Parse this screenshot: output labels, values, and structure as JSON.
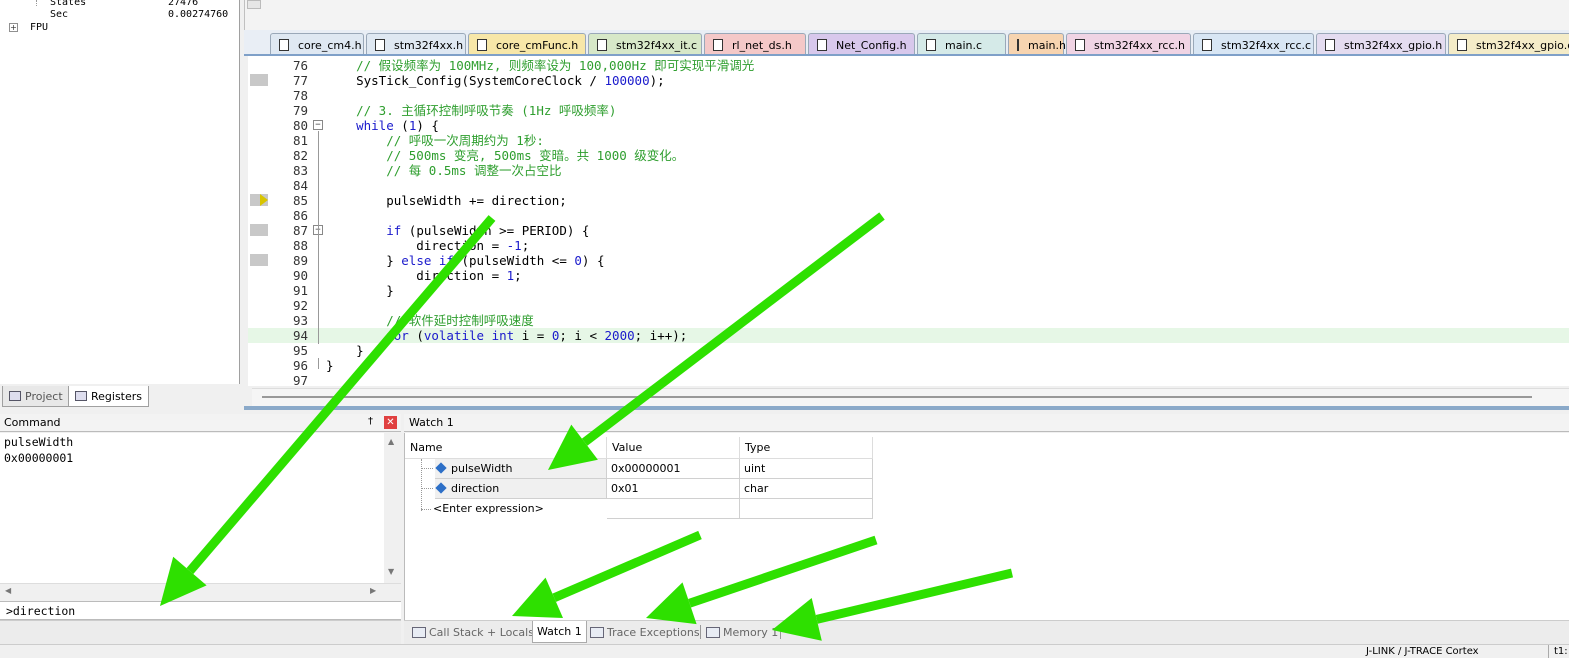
{
  "registers": {
    "rows": [
      {
        "name": "States",
        "value": "27476"
      },
      {
        "name": "Sec",
        "value": "0.00274760"
      }
    ],
    "tree_item": "FPU"
  },
  "left_tabs": [
    {
      "label": "Project",
      "icon": "project-icon"
    },
    {
      "label": "Registers",
      "icon": "registers-icon"
    }
  ],
  "file_tabs": [
    {
      "label": "core_cm4.h",
      "color": "#dfe8f2"
    },
    {
      "label": "stm32f4xx.h",
      "color": "#dfe8f2"
    },
    {
      "label": "core_cmFunc.h",
      "color": "#f7e7a8"
    },
    {
      "label": "stm32f4xx_it.c",
      "color": "#d7e8c8"
    },
    {
      "label": "rl_net_ds.h",
      "color": "#f4c8c8"
    },
    {
      "label": "Net_Config.h",
      "color": "#d8c8ec"
    },
    {
      "label": "main.c",
      "color": "#d5eae8"
    },
    {
      "label": "main.h",
      "color": "#f7d4b0"
    },
    {
      "label": "stm32f4xx_rcc.h",
      "color": "#f0d4e4"
    },
    {
      "label": "stm32f4xx_rcc.c",
      "color": "#d8e6f4"
    },
    {
      "label": "stm32f4xx_gpio.h",
      "color": "#e4dcf0"
    },
    {
      "label": "stm32f4xx_gpio.c",
      "color": "#f4ecc8"
    }
  ],
  "code_lines": [
    {
      "n": "76",
      "text": "    // 假设频率为 100MHz, 则频率设为 100,000Hz 即可实现平滑调光",
      "kind": "comment"
    },
    {
      "n": "77",
      "text": "    SysTick_Config(SystemCoreClock / 100000);",
      "kind": "code"
    },
    {
      "n": "78",
      "text": "",
      "kind": "code"
    },
    {
      "n": "79",
      "text": "    // 3. 主循环控制呼吸节奏 (1Hz 呼吸频率)",
      "kind": "comment"
    },
    {
      "n": "80",
      "text": "    while (1) {",
      "kind": "code"
    },
    {
      "n": "81",
      "text": "        // 呼吸一次周期约为 1秒:",
      "kind": "comment"
    },
    {
      "n": "82",
      "text": "        // 500ms 变亮, 500ms 变暗。共 1000 级变化。",
      "kind": "comment"
    },
    {
      "n": "83",
      "text": "        // 每 0.5ms 调整一次占空比",
      "kind": "comment"
    },
    {
      "n": "84",
      "text": "",
      "kind": "code"
    },
    {
      "n": "85",
      "text": "        pulseWidth += direction;",
      "kind": "code"
    },
    {
      "n": "86",
      "text": "",
      "kind": "code"
    },
    {
      "n": "87",
      "text": "        if (pulseWidth >= PERIOD) {",
      "kind": "code"
    },
    {
      "n": "88",
      "text": "            direction = -1;",
      "kind": "code"
    },
    {
      "n": "89",
      "text": "        } else if (pulseWidth <= 0) {",
      "kind": "code"
    },
    {
      "n": "90",
      "text": "            direction = 1;",
      "kind": "code"
    },
    {
      "n": "91",
      "text": "        }",
      "kind": "code"
    },
    {
      "n": "92",
      "text": "",
      "kind": "code"
    },
    {
      "n": "93",
      "text": "        // 软件延时控制呼吸速度",
      "kind": "comment"
    },
    {
      "n": "94",
      "text": "        for (volatile int i = 0; i < 2000; i++);",
      "kind": "code"
    },
    {
      "n": "95",
      "text": "    }",
      "kind": "code"
    },
    {
      "n": "96",
      "text": "}",
      "kind": "code"
    },
    {
      "n": "97",
      "text": "",
      "kind": "code"
    }
  ],
  "command": {
    "title": "Command",
    "pin_icon": "pin-icon",
    "close_icon": "close-icon",
    "output": [
      "pulseWidth",
      "0x00000001"
    ],
    "input": ">direction"
  },
  "watch": {
    "title": "Watch 1",
    "columns": [
      "Name",
      "Value",
      "Type"
    ],
    "rows": [
      {
        "name": "pulseWidth",
        "value": "0x00000001",
        "type": "uint"
      },
      {
        "name": "direction",
        "value": "0x01",
        "type": "char"
      }
    ],
    "enter_expression": "<Enter expression>"
  },
  "bottom_tabs": [
    {
      "label": "Call Stack + Locals",
      "icon": "call-stack-icon",
      "active": false
    },
    {
      "label": "Watch 1",
      "icon": "",
      "active": true
    },
    {
      "label": "Trace Exceptions",
      "icon": "trace-exceptions-icon",
      "active": false
    },
    {
      "label": "Memory 1",
      "icon": "memory-icon",
      "active": false
    }
  ],
  "status": {
    "debugger": "J-LINK / J-TRACE Cortex",
    "tail": "t1:"
  },
  "colors": {
    "annotation_arrow": "#2ee000",
    "comment": "#2e9e2e",
    "keyword": "#1a1acc",
    "current_line": "#e6f7e6"
  }
}
